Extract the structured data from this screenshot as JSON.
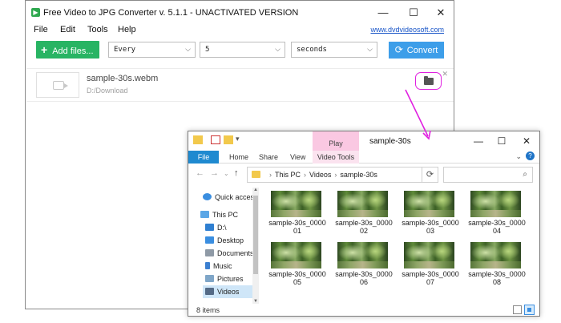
{
  "converter": {
    "title": "Free Video to JPG Converter v. 5.1.1 - UNACTIVATED VERSION",
    "menu": [
      "File",
      "Edit",
      "Tools",
      "Help"
    ],
    "site_link": "www.dvdvideosoft.com",
    "toolbar": {
      "add_files_label": "Add files...",
      "interval_mode": "Every",
      "interval_value": "5",
      "interval_unit": "seconds",
      "convert_label": "Convert"
    },
    "file": {
      "name": "sample-30s.webm",
      "path": "D:/Download"
    },
    "annotation_color": "#e020e0"
  },
  "explorer": {
    "title": "sample-30s",
    "play_tab": "Play",
    "ribbon_tabs": [
      "File",
      "Home",
      "Share",
      "View",
      "Video Tools"
    ],
    "address": [
      "This PC",
      "Videos",
      "sample-30s"
    ],
    "nav": [
      {
        "label": "Quick access",
        "icon": "star-icon"
      },
      {
        "label": "This PC",
        "icon": "computer-icon"
      },
      {
        "label": "D:\\",
        "icon": "download-icon"
      },
      {
        "label": "Desktop",
        "icon": "desktop-icon"
      },
      {
        "label": "Documents",
        "icon": "documents-icon"
      },
      {
        "label": "Music",
        "icon": "music-icon"
      },
      {
        "label": "Pictures",
        "icon": "pictures-icon"
      },
      {
        "label": "Videos",
        "icon": "videos-icon"
      }
    ],
    "files": [
      {
        "line1": "sample-30s_0000",
        "line2": "01"
      },
      {
        "line1": "sample-30s_0000",
        "line2": "02"
      },
      {
        "line1": "sample-30s_0000",
        "line2": "03"
      },
      {
        "line1": "sample-30s_0000",
        "line2": "04"
      },
      {
        "line1": "sample-30s_0000",
        "line2": "05"
      },
      {
        "line1": "sample-30s_0000",
        "line2": "06"
      },
      {
        "line1": "sample-30s_0000",
        "line2": "07"
      },
      {
        "line1": "sample-30s_0000",
        "line2": "08"
      }
    ],
    "status": "8 items"
  }
}
